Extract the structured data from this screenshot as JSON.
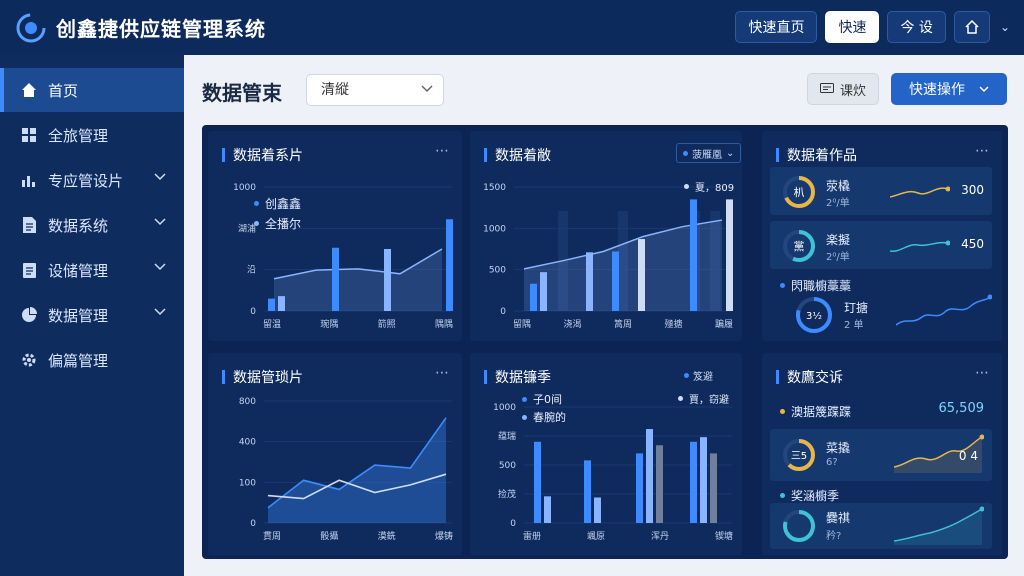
{
  "app": {
    "title": "创鑫捷供应链管理系统"
  },
  "topbar": {
    "quick_home": "快速直页",
    "quick": "快速",
    "settings": "今 设"
  },
  "sidebar": {
    "items": [
      {
        "label": "首页",
        "icon": "home-icon"
      },
      {
        "label": "全旅管理",
        "icon": "grid-icon"
      },
      {
        "label": "专应管设片",
        "icon": "bar-chart-icon"
      },
      {
        "label": "数据系统",
        "icon": "document-icon"
      },
      {
        "label": "设储管理",
        "icon": "clipboard-icon"
      },
      {
        "label": "数据管理",
        "icon": "pie-chart-icon"
      },
      {
        "label": "偏篇管理",
        "icon": "gear-icon"
      }
    ]
  },
  "header": {
    "title": "数据管束",
    "select_value": "清縦",
    "btn_light": "课炊",
    "btn_primary": "快速操作"
  },
  "panels": {
    "p1": {
      "title": "数据着系片",
      "legend": [
        "创鑫鑫",
        "全播尔"
      ],
      "chart_data": {
        "type": "bar",
        "yticks": [
          "1000",
          "湖浦",
          "沿",
          "0"
        ],
        "xticks": [
          "留温",
          "琬隅",
          "箭照",
          "隅隅"
        ],
        "ylim": [
          0,
          1000
        ],
        "series": [
          {
            "values": [
              100,
              120,
              510,
              500,
              740
            ]
          },
          {
            "values": [
              260,
              330,
              340,
              300,
              500
            ]
          }
        ]
      }
    },
    "p2": {
      "title": "数据着敝",
      "chip": "菠雁凰",
      "legend": "夏，809",
      "chart_data": {
        "type": "bar",
        "yticks": [
          "1500",
          "1000",
          "500",
          "0"
        ],
        "xticks": [
          "留隅",
          "浇渴",
          "篙周",
          "殛搪",
          "蹁履"
        ],
        "ylim": [
          0,
          1500
        ],
        "series": [
          {
            "values": [
              330,
              470,
              710,
              720,
              870,
              1350
            ]
          },
          {
            "values": [
              510,
              610,
              720,
              900,
              1020,
              1100
            ]
          }
        ]
      }
    },
    "p3": {
      "title": "数据着作品",
      "cards": [
        {
          "ring": "朳",
          "label": "荥橇",
          "sub": "2⁰/单",
          "value": "300"
        },
        {
          "ring": "黨",
          "label": "楽擬",
          "sub": "2⁰/单",
          "value": "450"
        }
      ],
      "subtitle": "閃職櫥藁藁",
      "card3": {
        "ring": "3⅟₂",
        "label": "玎搪",
        "sub": "2 单"
      }
    },
    "p4": {
      "title": "数据管琐片",
      "chart_data": {
        "type": "area",
        "yticks": [
          "800",
          "400",
          "100",
          "0"
        ],
        "xticks": [
          "貫周",
          "骰攝",
          "漠銑",
          "爆铸"
        ],
        "ylim": [
          0,
          800
        ],
        "series": [
          {
            "values": [
              100,
              280,
              220,
              380,
              360,
              690
            ]
          },
          {
            "values": [
              180,
              160,
              280,
              200,
              250,
              320
            ]
          }
        ]
      }
    },
    "p5": {
      "title": "数据镰季",
      "chip": "笈避",
      "legend": [
        "子0间",
        "春腕的"
      ],
      "legend_right": "賈，窃避",
      "chart_data": {
        "type": "bar",
        "yticks": [
          "1000",
          "蕴瑞",
          "500",
          "捡茂",
          "0"
        ],
        "xticks": [
          "雷册",
          "颯原",
          "浑丹",
          "锲塘"
        ],
        "ylim": [
          0,
          1000
        ],
        "series": [
          {
            "values": [
              700,
              540,
              600,
              810,
              700
            ]
          },
          {
            "values": [
              230,
              220,
              670,
              600,
              740
            ]
          }
        ]
      }
    },
    "p6": {
      "title": "数鷹交诉",
      "row1_label": "澳据篾蹀蹀",
      "row1_value": "65,509",
      "card": {
        "ring": "三5",
        "label": "菜撬",
        "sub": "6?",
        "value": "0 4"
      },
      "subtitle": "奖涵櫥季",
      "card2": {
        "label": "爨祺",
        "sub": "矜?"
      }
    }
  }
}
